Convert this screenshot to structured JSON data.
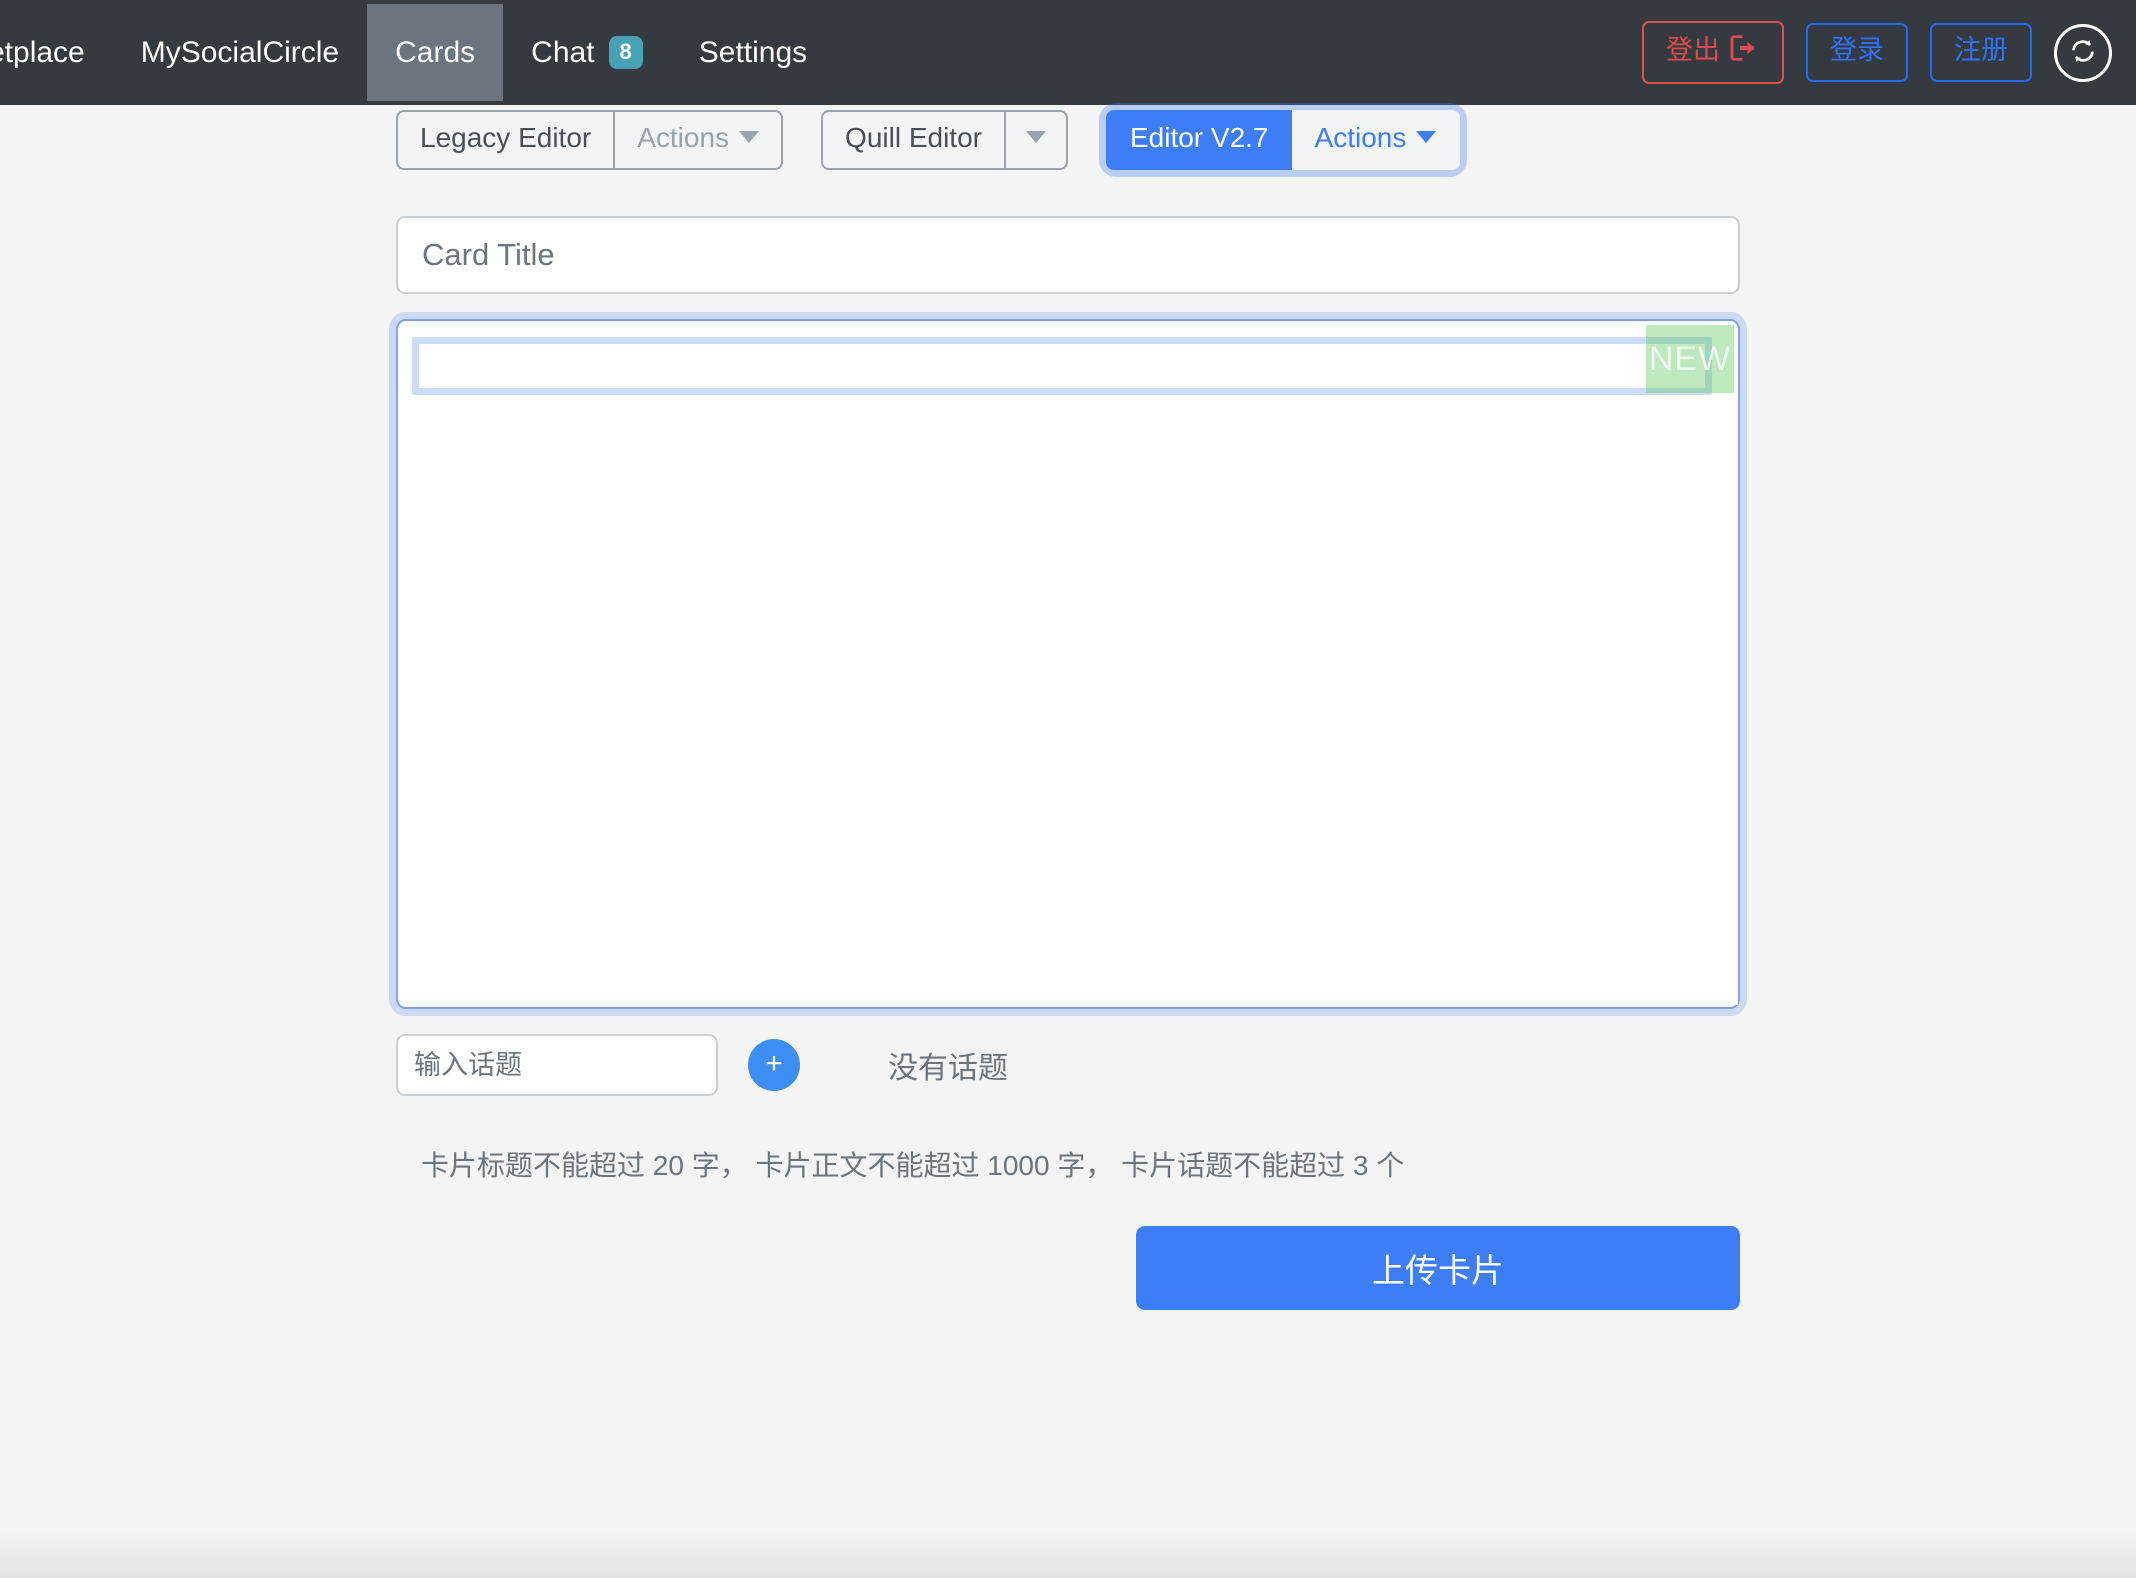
{
  "navbar": {
    "links": [
      {
        "label": "ketplace",
        "active": false
      },
      {
        "label": "MySocialCircle",
        "active": false
      },
      {
        "label": "Cards",
        "active": true
      },
      {
        "label": "Chat",
        "active": false,
        "badge": "8"
      },
      {
        "label": "Settings",
        "active": false
      }
    ],
    "logout_label": "登出",
    "login_label": "登录",
    "signup_label": "注册",
    "refresh_icon": "refresh-icon",
    "logout_icon": "sign-out-icon",
    "colors": {
      "background": "#343a40",
      "active_item": "#6c757d",
      "badge": "#49a1b5",
      "logout": "#dc4c4c",
      "link_blue": "#2f73f5"
    }
  },
  "toolbar": {
    "groups": [
      {
        "name": "legacy-editor",
        "main_label": "Legacy Editor",
        "dropdown_label": "Actions",
        "active": false,
        "dropdown_muted": true
      },
      {
        "name": "quill-editor",
        "main_label": "Quill Editor",
        "dropdown_label": "",
        "active": false,
        "dropdown_muted": false
      },
      {
        "name": "editor-v27",
        "main_label": "Editor V2.7",
        "dropdown_label": "Actions",
        "active": true,
        "dropdown_muted": false
      }
    ]
  },
  "card_form": {
    "title_placeholder": "Card Title",
    "title_value": "",
    "editor": {
      "new_badge": "NEW",
      "content": ""
    },
    "topic_placeholder": "输入话题",
    "topic_value": "",
    "add_topic_label": "+",
    "no_topic_text": "没有话题",
    "hint": "卡片标题不能超过 20 字， 卡片正文不能超过 1000 字， 卡片话题不能超过 3 个",
    "upload_label": "上传卡片"
  },
  "colors": {
    "primary": "#3d7ef7",
    "page_bg": "#f4f4f5",
    "muted_text": "#6c757d",
    "badge_green": "#63c863"
  }
}
